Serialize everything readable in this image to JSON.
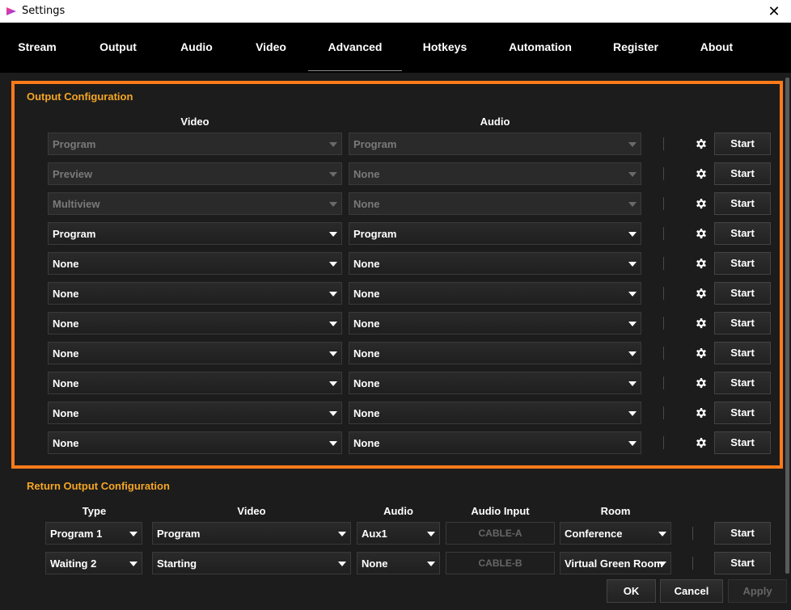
{
  "window": {
    "title": "Settings"
  },
  "tabs": [
    "Stream",
    "Output",
    "Audio",
    "Video",
    "Advanced",
    "Hotkeys",
    "Automation",
    "Register",
    "About"
  ],
  "active_tab": "Advanced",
  "output_config": {
    "title": "Output Configuration",
    "video_header": "Video",
    "audio_header": "Audio",
    "rows": [
      {
        "video": "Program",
        "audio": "Program",
        "disabled": true,
        "button": "Start"
      },
      {
        "video": "Preview",
        "audio": "None",
        "disabled": true,
        "button": "Start"
      },
      {
        "video": "Multiview",
        "audio": "None",
        "disabled": true,
        "button": "Start"
      },
      {
        "video": "Program",
        "audio": "Program",
        "disabled": false,
        "button": "Start"
      },
      {
        "video": "None",
        "audio": "None",
        "disabled": false,
        "button": "Start"
      },
      {
        "video": "None",
        "audio": "None",
        "disabled": false,
        "button": "Start"
      },
      {
        "video": "None",
        "audio": "None",
        "disabled": false,
        "button": "Start"
      },
      {
        "video": "None",
        "audio": "None",
        "disabled": false,
        "button": "Start"
      },
      {
        "video": "None",
        "audio": "None",
        "disabled": false,
        "button": "Start"
      },
      {
        "video": "None",
        "audio": "None",
        "disabled": false,
        "button": "Start"
      },
      {
        "video": "None",
        "audio": "None",
        "disabled": false,
        "button": "Start"
      }
    ]
  },
  "return_config": {
    "title": "Return Output Configuration",
    "headers": {
      "type": "Type",
      "video": "Video",
      "audio": "Audio",
      "audio_input": "Audio Input",
      "room": "Room"
    },
    "rows": [
      {
        "type": "Program 1",
        "video": "Program",
        "audio": "Aux1",
        "audio_input": "CABLE-A",
        "room": "Conference",
        "button": "Start"
      },
      {
        "type": "Waiting 2",
        "video": "Starting",
        "audio": "None",
        "audio_input": "CABLE-B",
        "room": "Virtual Green Room",
        "button": "Start"
      }
    ]
  },
  "footer": {
    "ok": "OK",
    "cancel": "Cancel",
    "apply": "Apply"
  },
  "colors": {
    "accent": "#ff7a1a",
    "section_title": "#f5a623",
    "background": "#1c1c1c"
  }
}
